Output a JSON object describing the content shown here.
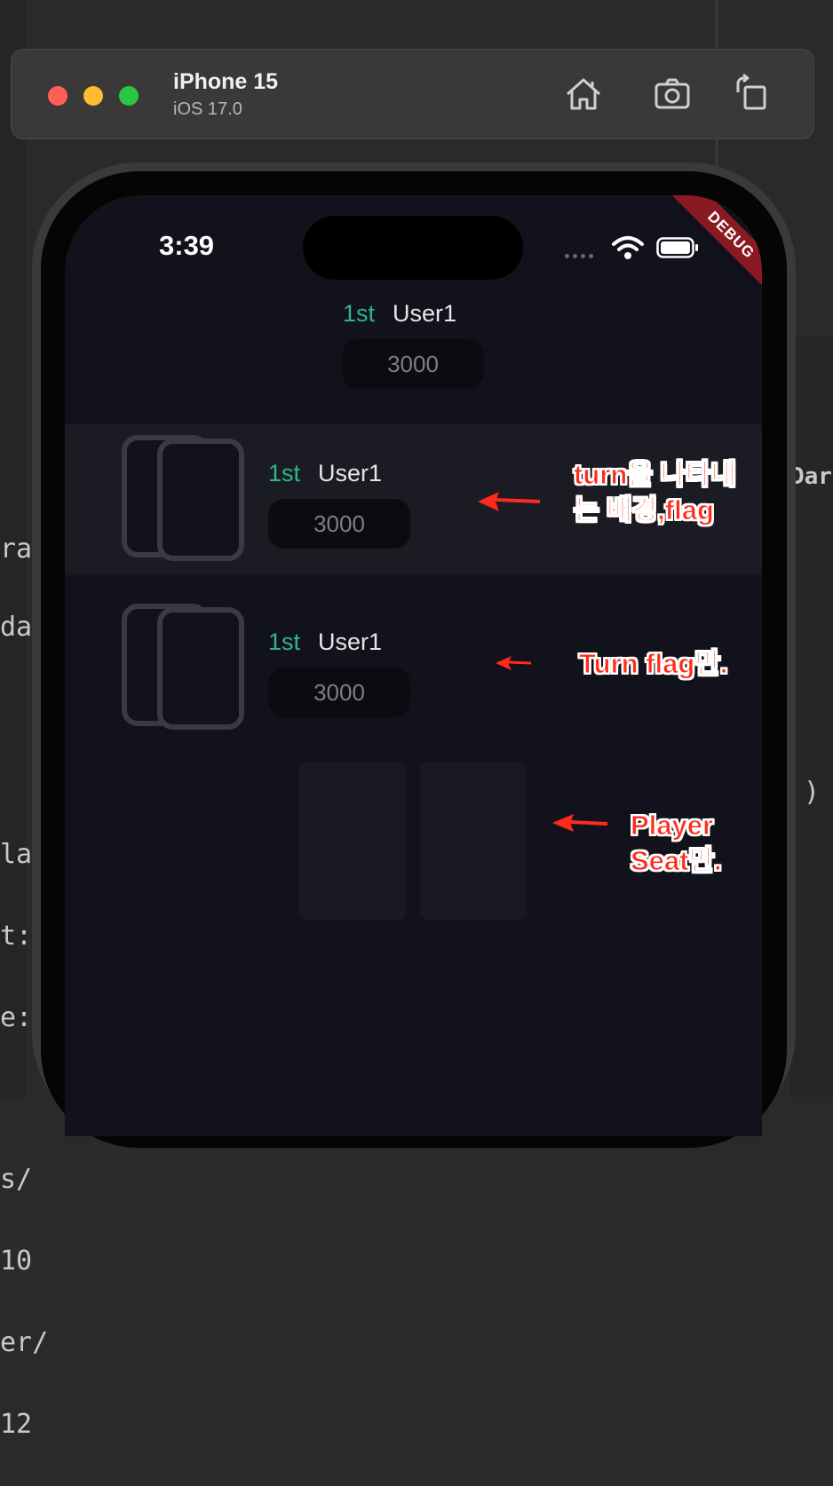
{
  "simulator": {
    "device_name": "iPhone 15",
    "os_version": "iOS 17.0",
    "toolbar_icons": [
      "home-icon",
      "screenshot-icon",
      "rotate-icon"
    ]
  },
  "background_code": {
    "lines_left": [
      "ra",
      "da",
      "",
      "",
      "la",
      "t:",
      "e:",
      "",
      "s/",
      "10",
      "er/",
      "12"
    ],
    "fragments_right": [
      "Dar",
      ")"
    ]
  },
  "status_bar": {
    "time": "3:39",
    "debug_banner": "DEBUG"
  },
  "players": [
    {
      "rank": "1st",
      "name": "User1",
      "chips": "3000"
    },
    {
      "rank": "1st",
      "name": "User1",
      "chips": "3000"
    },
    {
      "rank": "1st",
      "name": "User1",
      "chips": "3000"
    }
  ],
  "annotations": {
    "turn_background": "turn을 나타내\n는 배경,flag",
    "turn_flag": "Turn flag만.",
    "player_seat": "Player\nSeat만."
  },
  "colors": {
    "annotation_red": "#ff2a1a",
    "rank_green": "#2fb58b",
    "screen_bg": "#12121c"
  }
}
